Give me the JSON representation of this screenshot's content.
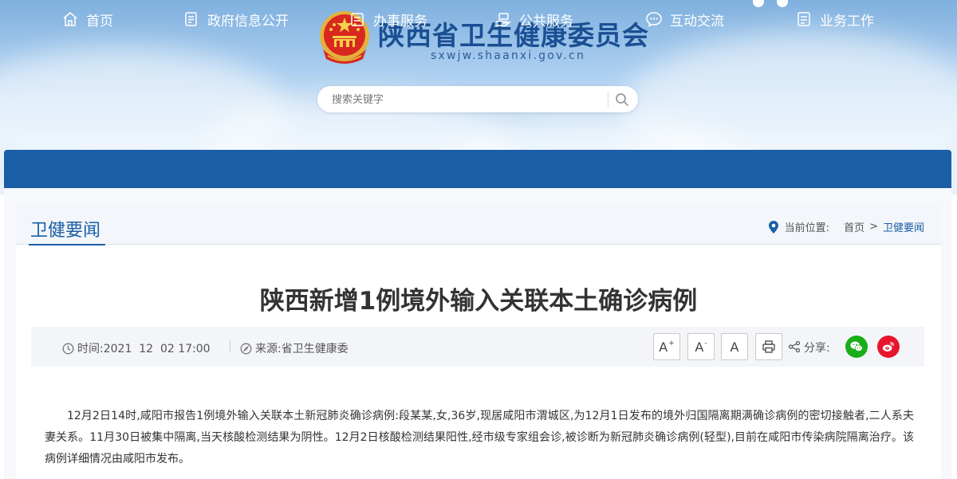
{
  "site": {
    "title": "陕西省卫生健康委员会",
    "domain": "sxwjw.shaanxi.gov.cn",
    "search_placeholder": "搜索关键字"
  },
  "nav": {
    "items": [
      {
        "label": "首页",
        "icon": "home-icon"
      },
      {
        "label": "政府信息公开",
        "icon": "document-list-icon"
      },
      {
        "label": "办事服务",
        "icon": "clipboard-icon"
      },
      {
        "label": "公共服务",
        "icon": "hand-service-icon"
      },
      {
        "label": "互动交流",
        "icon": "chat-icon"
      },
      {
        "label": "业务工作",
        "icon": "briefcase-icon"
      }
    ]
  },
  "section": {
    "title": "卫健要闻",
    "breadcrumb_label": "当前位置:",
    "breadcrumb_home": "首页",
    "breadcrumb_sep": ">",
    "breadcrumb_current": "卫健要闻"
  },
  "article": {
    "title": "陕西新增1例境外输入关联本土确诊病例",
    "time_label": "时间:2021  12  02 17:00",
    "source_label": "来源:省卫生健康委",
    "font_larger": "A",
    "font_smaller": "A",
    "font_reset": "A",
    "share_label": "分享:",
    "body": "12月2日14时,咸阳市报告1例境外输入关联本土新冠肺炎确诊病例:段某某,女,36岁,现居咸阳市渭城区,为12月1日发布的境外归国隔离期满确诊病例的密切接触者,二人系夫妻关系。11月30日被集中隔离,当天核酸检测结果为阴性。12月2日核酸检测结果阳性,经市级专家组会诊,被诊断为新冠肺炎确诊病例(轻型),目前在咸阳市传染病院隔离治疗。该病例详细情况由咸阳市发布。"
  },
  "colors": {
    "nav_bg": "#1a5fa6",
    "title_blue": "#1b4f93",
    "wechat": "#1aad19",
    "weibo": "#e6162d"
  }
}
